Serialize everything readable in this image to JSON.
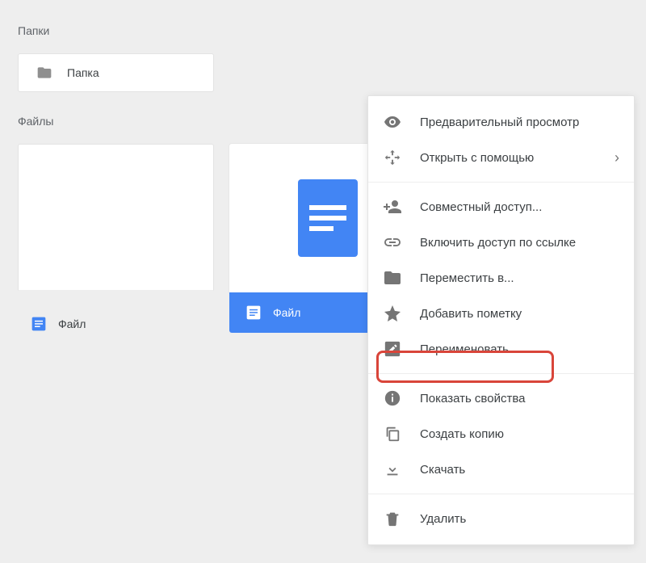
{
  "sections": {
    "folders_label": "Папки",
    "files_label": "Файлы"
  },
  "folders": [
    {
      "name": "Папка"
    }
  ],
  "files": [
    {
      "name": "Файл",
      "selected": false
    },
    {
      "name": "Файл",
      "selected": true
    }
  ],
  "context_menu": {
    "preview": "Предварительный просмотр",
    "open_with": "Открыть с помощью",
    "share": "Совместный доступ...",
    "get_link": "Включить доступ по ссылке",
    "move_to": "Переместить в...",
    "star": "Добавить пометку",
    "rename": "Переименовать...",
    "details": "Показать свойства",
    "make_copy": "Создать копию",
    "download": "Скачать",
    "delete": "Удалить"
  },
  "colors": {
    "accent": "#4285f4",
    "highlight_border": "#d9453a",
    "icon_gray": "#757575"
  }
}
